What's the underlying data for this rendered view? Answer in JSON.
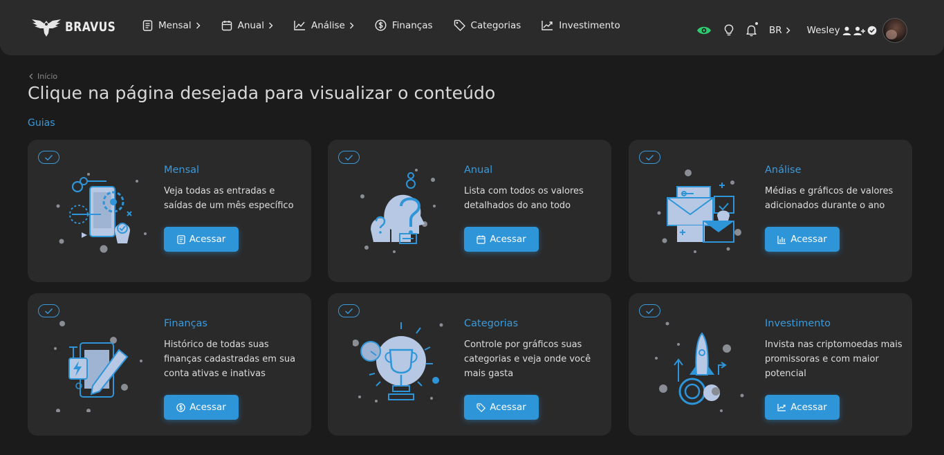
{
  "brand": {
    "name": "BRAVUS"
  },
  "nav": {
    "items": [
      {
        "label": "Mensal",
        "icon": "document-icon",
        "chevron": true
      },
      {
        "label": "Anual",
        "icon": "calendar-icon",
        "chevron": true
      },
      {
        "label": "Análise",
        "icon": "line-chart-icon",
        "chevron": true
      },
      {
        "label": "Finanças",
        "icon": "dollar-circle-icon",
        "chevron": false
      },
      {
        "label": "Categorias",
        "icon": "tag-icon",
        "chevron": false
      },
      {
        "label": "Investimento",
        "icon": "trending-up-icon",
        "chevron": false
      }
    ],
    "language": "BR",
    "user_name": "Wesley"
  },
  "breadcrumb": {
    "label": "Início"
  },
  "page": {
    "title": "Clique na página desejada para visualizar o conteúdo",
    "section": "Guias"
  },
  "cards": [
    {
      "title": "Mensal",
      "description": "Veja todas as entradas e saídas de um mês específico",
      "button": "Acessar",
      "button_icon": "document-icon",
      "illustration": "phone-gears-icon"
    },
    {
      "title": "Anual",
      "description": "Lista com todos os valores detalhados do ano todo",
      "button": "Acessar",
      "button_icon": "calendar-icon",
      "illustration": "head-question-icon"
    },
    {
      "title": "Análise",
      "description": "Médias e gráficos de valores adicionados durante o ano",
      "button": "Acessar",
      "button_icon": "bar-chart-icon",
      "illustration": "envelopes-icon"
    },
    {
      "title": "Finanças",
      "description": "Histórico de todas suas finanças cadastradas em sua conta ativas e inativas",
      "button": "Acessar",
      "button_icon": "dollar-circle-icon",
      "illustration": "tablet-pen-icon"
    },
    {
      "title": "Categorias",
      "description": "Controle por gráficos suas categorias e veja onde você mais gasta",
      "button": "Acessar",
      "button_icon": "tag-icon",
      "illustration": "trophy-icon"
    },
    {
      "title": "Investimento",
      "description": "Invista nas criptomoedas mais promissoras e com maior potencial",
      "button": "Acessar",
      "button_icon": "trending-up-icon",
      "illustration": "rocket-icon"
    }
  ],
  "colors": {
    "accent": "#2d95d8",
    "link": "#3a9bdc",
    "eye": "#2ecc71",
    "card_bg": "#2a2a2b",
    "bg": "#1b1b1c",
    "illus_light": "#b6c8e4",
    "illus_mid": "#8a8d94"
  }
}
